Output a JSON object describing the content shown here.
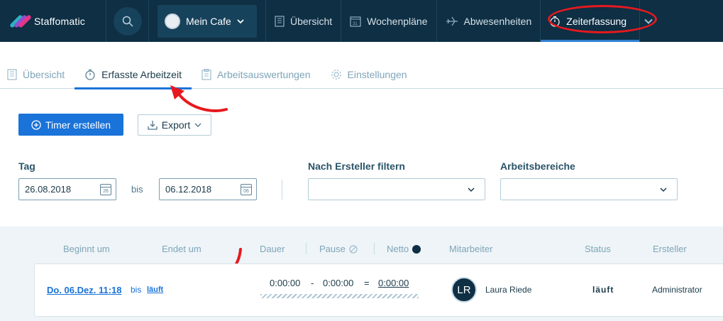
{
  "app": {
    "brand_name": "Staffomatic"
  },
  "topnav": {
    "cafe_label": "Mein Cafe",
    "items": [
      {
        "label": "Übersicht",
        "icon": "building-icon"
      },
      {
        "label": "Wochenpläne",
        "icon": "calendar-icon"
      },
      {
        "label": "Abwesenheiten",
        "icon": "plane-icon"
      },
      {
        "label": "Zeiterfassung",
        "icon": "stopwatch-icon",
        "active": true
      }
    ]
  },
  "subtabs": [
    {
      "label": "Übersicht",
      "icon": "building-icon"
    },
    {
      "label": "Erfasste Arbeitzeit",
      "icon": "stopwatch-icon",
      "active": true
    },
    {
      "label": "Arbeitsauswertungen",
      "icon": "clipboard-icon"
    },
    {
      "label": "Einstellungen",
      "icon": "gear-icon"
    }
  ],
  "actions": {
    "timer_label": "Timer erstellen",
    "export_label": "Export"
  },
  "filters": {
    "tag_label": "Tag",
    "date_from": "26.08.2018",
    "date_from_cal": "26",
    "bis": "bis",
    "date_to": "06.12.2018",
    "date_to_cal": "06",
    "creator_label": "Nach Ersteller filtern",
    "workareas_label": "Arbeitsbereiche"
  },
  "table": {
    "headers": [
      "Beginnt um",
      "Endet um",
      "Dauer",
      "Pause",
      "Netto",
      "Mitarbeiter",
      "Status",
      "Ersteller"
    ],
    "row": {
      "begin": "Do. 06.Dez. 11:18",
      "bis": "bis",
      "end": "läuft",
      "duration": "0:00:00",
      "minus": "-",
      "pause": "0:00:00",
      "equals": "=",
      "net": "0:00:00",
      "initials": "LR",
      "employee": "Laura Riede",
      "status": "läuft",
      "creator": "Administrator"
    }
  },
  "colors": {
    "nav_bg": "#0e2f44",
    "accent": "#1a73d9",
    "annotation_red": "#e6191f"
  }
}
